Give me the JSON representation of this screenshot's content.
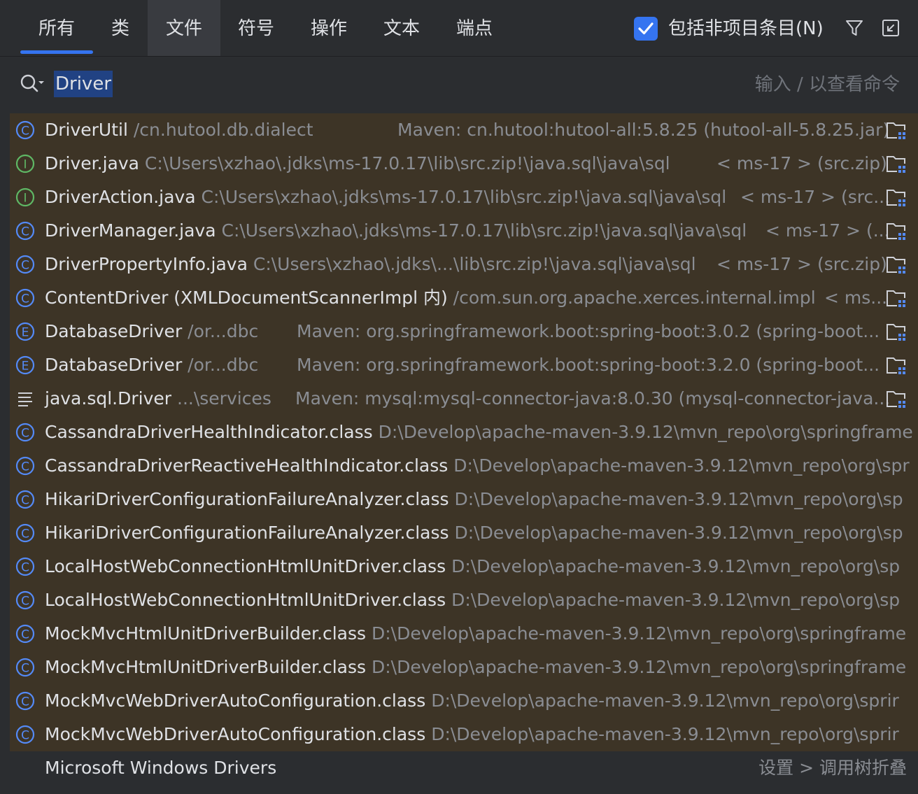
{
  "tabs": [
    {
      "label": "所有"
    },
    {
      "label": "类"
    },
    {
      "label": "文件"
    },
    {
      "label": "符号"
    },
    {
      "label": "操作"
    },
    {
      "label": "文本"
    },
    {
      "label": "端点"
    }
  ],
  "include_non_project": {
    "label": "包括非项目条目(N)",
    "checked": true
  },
  "search": {
    "value": "Driver",
    "hint": "输入 / 以查看命令"
  },
  "results": [
    {
      "kind": "class",
      "name": "DriverUtil",
      "loc": "/cn.hutool.db.dialect",
      "lib": "Maven: cn.hutool:hutool-all:5.8.25 (hutool-all-5.8.25.jar)"
    },
    {
      "kind": "interface",
      "name": "Driver.java",
      "loc": "C:\\Users\\xzhao\\.jdks\\ms-17.0.17\\lib\\src.zip!\\java.sql\\java\\sql",
      "lib": "< ms-17 > (src.zip)"
    },
    {
      "kind": "interface",
      "name": "DriverAction.java",
      "loc": "C:\\Users\\xzhao\\.jdks\\ms-17.0.17\\lib\\src.zip!\\java.sql\\java\\sql",
      "lib": "< ms-17 > (src..."
    },
    {
      "kind": "class",
      "name": "DriverManager.java",
      "loc": "C:\\Users\\xzhao\\.jdks\\ms-17.0.17\\lib\\src.zip!\\java.sql\\java\\sql",
      "lib": "< ms-17 > (..."
    },
    {
      "kind": "class",
      "name": "DriverPropertyInfo.java",
      "loc": "C:\\Users\\xzhao\\.jdks\\...\\lib\\src.zip!\\java.sql\\java\\sql",
      "lib": "< ms-17 > (src.zip)"
    },
    {
      "kind": "class",
      "name": "ContentDriver (XMLDocumentScannerImpl 内)",
      "loc": "/com.sun.org.apache.xerces.internal.impl",
      "lib": "< ms..."
    },
    {
      "kind": "enum",
      "name": "DatabaseDriver",
      "loc": "/or...dbc",
      "lib": "Maven: org.springframework.boot:spring-boot:3.0.2 (spring-boot..."
    },
    {
      "kind": "enum",
      "name": "DatabaseDriver",
      "loc": "/or...dbc",
      "lib": "Maven: org.springframework.boot:spring-boot:3.2.0 (spring-boot..."
    },
    {
      "kind": "file",
      "name": "java.sql.Driver",
      "loc": "...\\services",
      "lib": "Maven: mysql:mysql-connector-java:8.0.30 (mysql-connector-java..."
    },
    {
      "kind": "class",
      "name": "CassandraDriverHealthIndicator.class",
      "loc": "D:\\Develop\\apache-maven-3.9.12\\mvn_repo\\org\\springframe",
      "lib": ""
    },
    {
      "kind": "class",
      "name": "CassandraDriverReactiveHealthIndicator.class",
      "loc": "D:\\Develop\\apache-maven-3.9.12\\mvn_repo\\org\\spr",
      "lib": ""
    },
    {
      "kind": "class",
      "name": "HikariDriverConfigurationFailureAnalyzer.class",
      "loc": "D:\\Develop\\apache-maven-3.9.12\\mvn_repo\\org\\sp",
      "lib": ""
    },
    {
      "kind": "class",
      "name": "HikariDriverConfigurationFailureAnalyzer.class",
      "loc": "D:\\Develop\\apache-maven-3.9.12\\mvn_repo\\org\\sp",
      "lib": ""
    },
    {
      "kind": "class",
      "name": "LocalHostWebConnectionHtmlUnitDriver.class",
      "loc": "D:\\Develop\\apache-maven-3.9.12\\mvn_repo\\org\\sp",
      "lib": ""
    },
    {
      "kind": "class",
      "name": "LocalHostWebConnectionHtmlUnitDriver.class",
      "loc": "D:\\Develop\\apache-maven-3.9.12\\mvn_repo\\org\\sp",
      "lib": ""
    },
    {
      "kind": "class",
      "name": "MockMvcHtmlUnitDriverBuilder.class",
      "loc": "D:\\Develop\\apache-maven-3.9.12\\mvn_repo\\org\\springframe",
      "lib": ""
    },
    {
      "kind": "class",
      "name": "MockMvcHtmlUnitDriverBuilder.class",
      "loc": "D:\\Develop\\apache-maven-3.9.12\\mvn_repo\\org\\springframe",
      "lib": ""
    },
    {
      "kind": "class",
      "name": "MockMvcWebDriverAutoConfiguration.class",
      "loc": "D:\\Develop\\apache-maven-3.9.12\\mvn_repo\\org\\sprir",
      "lib": ""
    },
    {
      "kind": "class",
      "name": "MockMvcWebDriverAutoConfiguration.class",
      "loc": "D:\\Develop\\apache-maven-3.9.12\\mvn_repo\\org\\sprir",
      "lib": ""
    }
  ],
  "action_result": {
    "name": "Microsoft Windows Drivers",
    "crumb": "设置 > 调用树折叠"
  },
  "colors": {
    "accent": "#3574f0",
    "class_icon": "#548af7",
    "interface_icon": "#5fb865",
    "selection_bg": "#3d3426"
  }
}
